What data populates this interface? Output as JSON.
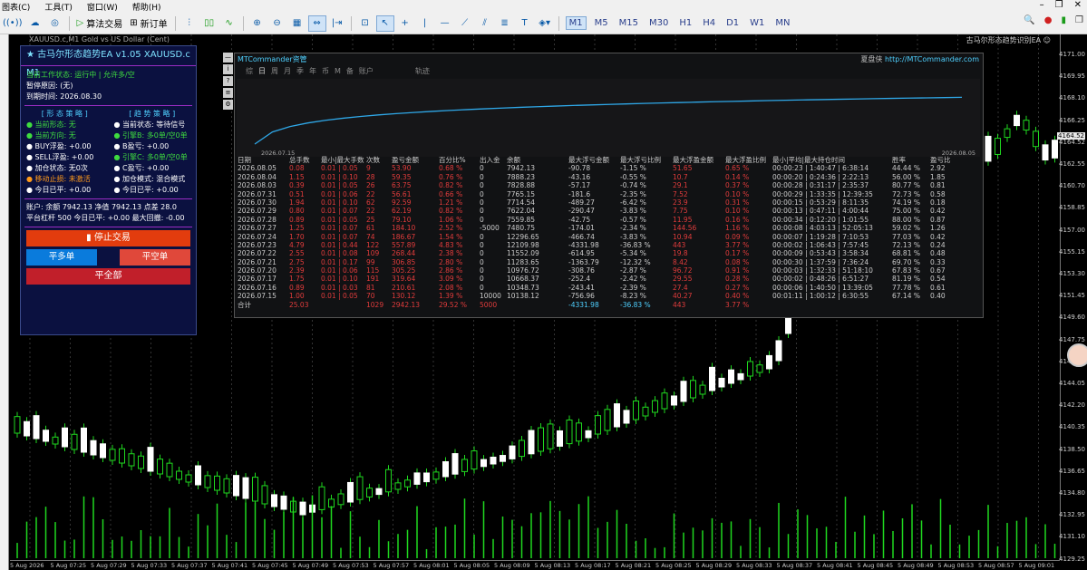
{
  "menu": {
    "items": [
      "图表(C)",
      "工具(T)",
      "窗口(W)",
      "帮助(H)"
    ]
  },
  "toolbar": {
    "algo_trading": "算法交易",
    "new_order": "新订单",
    "timeframes": [
      "M1",
      "M5",
      "M15",
      "M30",
      "H1",
      "H4",
      "D1",
      "W1",
      "MN"
    ],
    "active_timeframe": "M1"
  },
  "chart": {
    "title": "XAUUSD.c,M1  Gold vs US Dollar (Cent)",
    "ea_label": "古马尔形态趋势识别EA ☺",
    "price_ticks": [
      "4171.00",
      "4169.95",
      "4168.10",
      "4166.25",
      "4164.52",
      "4162.55",
      "4160.70",
      "4158.85",
      "4157.00",
      "4155.15",
      "4153.30",
      "4151.45",
      "4149.60",
      "4147.75",
      "4145.90",
      "4144.05",
      "4142.20",
      "4140.35",
      "4138.50",
      "4136.65",
      "4134.80",
      "4132.95",
      "4131.10",
      "4129.25"
    ],
    "current_price": "4164.52",
    "time_ticks": [
      "5 Aug 2026",
      "5 Aug 07:25",
      "5 Aug 07:29",
      "5 Aug 07:33",
      "5 Aug 07:37",
      "5 Aug 07:41",
      "5 Aug 07:45",
      "5 Aug 07:49",
      "5 Aug 07:53",
      "5 Aug 07:57",
      "5 Aug 08:01",
      "5 Aug 08:05",
      "5 Aug 08:09",
      "5 Aug 08:13",
      "5 Aug 08:17",
      "5 Aug 08:21",
      "5 Aug 08:25",
      "5 Aug 08:29",
      "5 Aug 08:33",
      "5 Aug 08:37",
      "5 Aug 08:41",
      "5 Aug 08:45",
      "5 Aug 08:49",
      "5 Aug 08:53",
      "5 Aug 08:57",
      "5 Aug 09:01"
    ]
  },
  "ea": {
    "title": "★ 古马尔形态趋势EA v1.05  XAUUSD.c  M1",
    "status": "当前工作状态: 运行中 | 允许多/空",
    "pause": "暂停原因: (无)",
    "expire": "到期时间: 2026.08.30",
    "left_head": "[ 形 态 策 略 ]",
    "right_head": "[ 趋 势 策 略 ]",
    "left": [
      "● 当前形态: 无",
      "● 当前方向: 无",
      "● BUY浮盈: +0.00",
      "● SELL浮盈: +0.00",
      "● 加仓状态: 无0次",
      "● 移动止损: 未激活",
      "● 今日已平: +0.00"
    ],
    "right": [
      "● 当前状态: 等待信号",
      "● 引擎B: 多0单/空0单",
      "● B盈亏: +0.00",
      "● 引擎C: 多0单/空0单",
      "● C盈亏: +0.00",
      "● 加仓模式: 混合模式",
      "● 今日已平: +0.00"
    ],
    "account1": "账户: 余额 7942.13  净值 7942.13  点差 28.0",
    "account2": "平台杠杆 500  今日已平: +0.00  最大回撤: -0.00",
    "stop": "▮ 停止交易",
    "buy": "平多单",
    "sell": "平空单",
    "close_all": "平全部"
  },
  "mtc": {
    "title": "MTCommander资管",
    "brand": "夏盘侠",
    "url": "http://MTCommander.com",
    "tabs": [
      "综",
      "日",
      "周",
      "月",
      "季",
      "年",
      "币",
      "M",
      "备",
      "账户",
      "轨迹"
    ],
    "active_tab": "日",
    "chart_start": "2026.07.15",
    "chart_end": "2026.08.05",
    "headers": [
      "日期",
      "总手数",
      "最小|最大手数",
      "次数",
      "盈亏金额",
      "百分比%",
      "出入金",
      "余额",
      "最大浮亏金额",
      "最大浮亏比例",
      "最大浮盈金额",
      "最大浮盈比例",
      "最小|平均|最大持仓时间",
      "胜率",
      "盈亏比"
    ],
    "rows": [
      [
        "2026.08.05",
        "0.08",
        "0.01 | 0.05",
        "9",
        "53.90",
        "0.68 %",
        "0",
        "7942.13",
        "-90.78",
        "-1.15 %",
        "51.65",
        "0.65 %",
        "00:00:23 | 1:40:47 | 6:38:14",
        "44.44 %",
        "2.92"
      ],
      [
        "2026.08.04",
        "1.15",
        "0.01 | 0.10",
        "28",
        "59.35",
        "0.76 %",
        "0",
        "7888.23",
        "-43.16",
        "-0.55 %",
        "10.7",
        "0.14 %",
        "00:00:20 | 0:24:36 | 2:22:13",
        "56.00 %",
        "1.85"
      ],
      [
        "2026.08.03",
        "0.39",
        "0.01 | 0.05",
        "26",
        "63.75",
        "0.82 %",
        "0",
        "7828.88",
        "-57.17",
        "-0.74 %",
        "29.1",
        "0.37 %",
        "00:00:28 | 0:31:17 | 2:35:37",
        "80.77 %",
        "0.81"
      ],
      [
        "2026.07.31",
        "0.51",
        "0.01 | 0.06",
        "22",
        "56.61",
        "0.66 %",
        "0",
        "7765.15",
        "-181.6",
        "-2.35 %",
        "7.52",
        "0.10 %",
        "00:00:29 | 1:33:35 | 12:39:35",
        "72.73 %",
        "0.58"
      ],
      [
        "2026.07.30",
        "1.94",
        "0.01 | 0.10",
        "62",
        "92.59",
        "1.21 %",
        "0",
        "7714.54",
        "-489.27",
        "-6.42 %",
        "23.9",
        "0.31 %",
        "00:00:15 | 0:53:29 | 8:11:35",
        "74.19 %",
        "0.18"
      ],
      [
        "2026.07.29",
        "0.80",
        "0.01 | 0.07",
        "22",
        "62.19",
        "0.82 %",
        "0",
        "7622.04",
        "-290.47",
        "-3.83 %",
        "7.75",
        "0.10 %",
        "00:00:13 | 0:47:11 | 4:00:44",
        "75.00 %",
        "0.42"
      ],
      [
        "2026.07.28",
        "0.89",
        "0.01 | 0.05",
        "25",
        "79.10",
        "1.06 %",
        "0",
        "7559.85",
        "-42.75",
        "-0.57 %",
        "11.95",
        "0.16 %",
        "00:00:34 | 0:12:20 | 1:01:55",
        "88.00 %",
        "0.87"
      ],
      [
        "2026.07.27",
        "1.25",
        "0.01 | 0.07",
        "61",
        "184.10",
        "2.52 %",
        "-5000",
        "7480.75",
        "-174.01",
        "-2.34 %",
        "144.56",
        "1.16 %",
        "00:00:08 | 4:03:13 | 52:05:13",
        "59.02 %",
        "1.26"
      ],
      [
        "2026.07.24",
        "1.70",
        "0.01 | 0.07",
        "74",
        "186.67",
        "1.54 %",
        "0",
        "12296.65",
        "-466.74",
        "-3.83 %",
        "10.94",
        "0.09 %",
        "00:00:07 | 1:19:28 | 7:10:53",
        "77.03 %",
        "0.42"
      ],
      [
        "2026.07.23",
        "4.79",
        "0.01 | 0.44",
        "122",
        "557.89",
        "4.83 %",
        "0",
        "12109.98",
        "-4331.98",
        "-36.83 %",
        "443",
        "3.77 %",
        "00:00:02 | 1:06:43 | 7:57:45",
        "72.13 %",
        "0.24"
      ],
      [
        "2026.07.22",
        "2.55",
        "0.01 | 0.08",
        "109",
        "268.44",
        "2.38 %",
        "0",
        "11552.09",
        "-614.95",
        "-5.34 %",
        "19.8",
        "0.17 %",
        "00:00:09 | 0:53:43 | 3:58:34",
        "68.81 %",
        "0.48"
      ],
      [
        "2026.07.21",
        "2.75",
        "0.01 | 0.17",
        "99",
        "306.85",
        "2.80 %",
        "0",
        "11283.65",
        "-1363.79",
        "-12.32 %",
        "8.42",
        "0.08 %",
        "00:00:30 | 1:37:59 | 7:36:24",
        "69.70 %",
        "0.33"
      ],
      [
        "2026.07.20",
        "2.39",
        "0.01 | 0.06",
        "115",
        "305.25",
        "2.86 %",
        "0",
        "10976.72",
        "-308.76",
        "-2.87 %",
        "96.72",
        "0.91 %",
        "00:00:03 | 1:32:33 | 51:18:10",
        "67.83 %",
        "0.67"
      ],
      [
        "2026.07.17",
        "1.75",
        "0.01 | 0.10",
        "191",
        "319.64",
        "3.09 %",
        "0",
        "10668.37",
        "-252.4",
        "-2.42 %",
        "29.55",
        "0.28 %",
        "00:00:02 | 0:48:26 | 6:51:27",
        "81.19 %",
        "0.54"
      ],
      [
        "2026.07.16",
        "0.89",
        "0.01 | 0.03",
        "81",
        "210.61",
        "2.08 %",
        "0",
        "10348.73",
        "-243.41",
        "-2.39 %",
        "27.4",
        "0.27 %",
        "00:00:06 | 1:40:50 | 13:39:05",
        "77.78 %",
        "0.61"
      ],
      [
        "2026.07.15",
        "1.00",
        "0.01 | 0.05",
        "70",
        "130.12",
        "1.39 %",
        "10000",
        "10138.12",
        "-756.96",
        "-8.23 %",
        "40.27",
        "0.40 %",
        "00:01:11 | 1:00:12 | 6:30:55",
        "67.14 %",
        "0.40"
      ]
    ],
    "total": [
      "合计",
      "25.03",
      "",
      "1029",
      "2942.13",
      "29.52 %",
      "5000",
      "",
      "-4331.98",
      "-36.83 %",
      "443",
      "3.77 %",
      "",
      "",
      ""
    ]
  }
}
